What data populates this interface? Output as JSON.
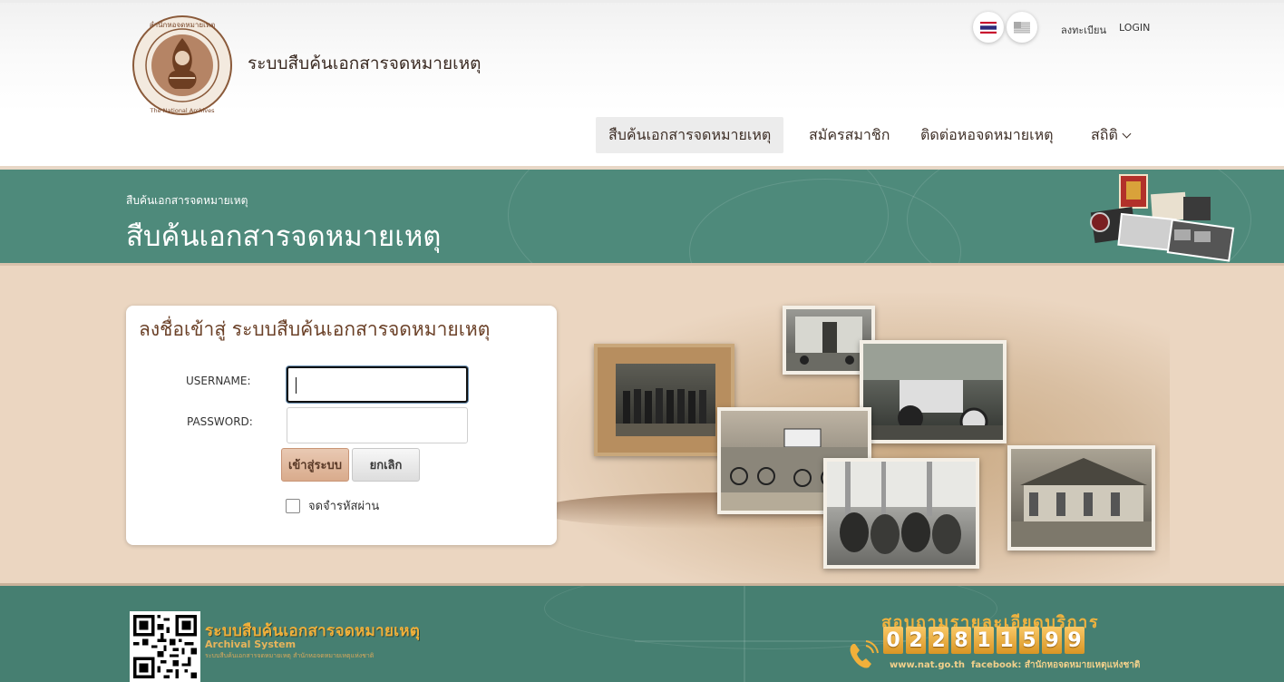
{
  "header": {
    "logo_name": "national-archives-seal",
    "logo_text": "สำนักหอจดหมายเหตุแห่งชาติ The National Archives of Thailand",
    "site_title": "ระบบสืบค้นเอกสารจดหมายเหตุ",
    "languages": [
      "Thai",
      "English"
    ],
    "register_label": "ลงทะเบียน",
    "login_label": "LOGIN",
    "nav": {
      "search": "สืบค้นเอกสารจดหมายเหตุ",
      "member": "สมัครสมาชิก",
      "contact": "ติดต่อหอจดหมายเหตุ",
      "stats": "สถิติ"
    }
  },
  "banner": {
    "breadcrumb": "สืบค้นเอกสารจดหมายเหตุ",
    "title": "สืบค้นเอกสารจดหมายเหตุ"
  },
  "login": {
    "title": "ลงชื่อเข้าสู่ ระบบสืบค้นเอกสารจดหมายเหตุ",
    "username_label": "USERNAME:",
    "password_label": "PASSWORD:",
    "username_value": "",
    "password_value": "",
    "submit_label": "เข้าสู่ระบบ",
    "cancel_label": "ยกเลิก",
    "remember_label": "จดจำรหัสผ่าน",
    "remember_checked": false
  },
  "footer": {
    "title": "ระบบสืบค้นเอกสารจดหมายเหตุ",
    "subtitle": "Archival System",
    "tiny_text": "ระบบสืบค้นเอกสารจดหมายเหตุ สำนักหอจดหมายเหตุแห่งชาติ",
    "contact_heading": "สอบถามรายละเอียดบริการ",
    "phone_digits": [
      "0",
      "2",
      "2",
      "8",
      "1",
      "1",
      "5",
      "9",
      "9"
    ],
    "web": "www.nat.go.th",
    "facebook": "facebook: สำนักหอจดหมายเหตุแห่งชาติ"
  },
  "colors": {
    "teal": "#4e8a7b",
    "beige": "#ebd6c1",
    "brown_title": "#6b4128",
    "gold": "#f0b23e"
  }
}
